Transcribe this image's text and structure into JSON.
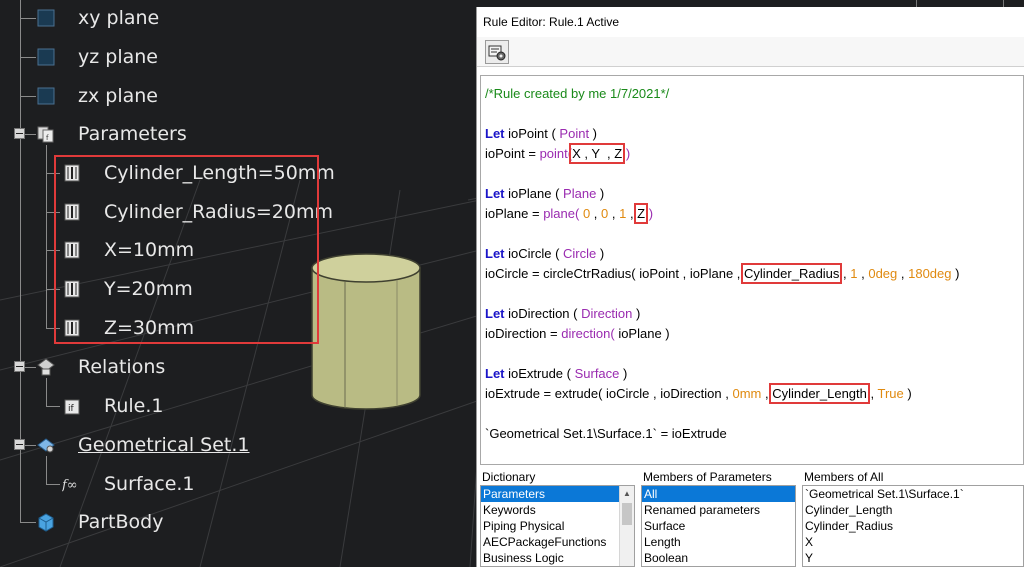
{
  "tree": {
    "items": [
      {
        "label": "xy plane"
      },
      {
        "label": "yz plane"
      },
      {
        "label": "zx plane"
      },
      {
        "label": "Parameters"
      },
      {
        "label": "Cylinder_Length=50mm"
      },
      {
        "label": "Cylinder_Radius=20mm"
      },
      {
        "label": "X=10mm"
      },
      {
        "label": "Y=20mm"
      },
      {
        "label": "Z=30mm"
      },
      {
        "label": "Relations"
      },
      {
        "label": "Rule.1"
      },
      {
        "label": "Geometrical Set.1"
      },
      {
        "label": "Surface.1"
      },
      {
        "label": "PartBody"
      }
    ]
  },
  "rule_editor": {
    "title": "Rule Editor: Rule.1 Active",
    "code": {
      "comment": "/*Rule created by me 1/7/2021*/",
      "let": "Let",
      "l_point_decl_var": " ioPoint ( ",
      "l_point_decl_type": "Point",
      "l_point_decl_end": " )",
      "l_point_assign": "ioPoint = ",
      "l_point_fn": "point(",
      "l_point_args": "X , Y  , Z",
      "l_point_close": " )",
      "l_plane_decl_var": " ioPlane ( ",
      "l_plane_decl_type": "Plane",
      "l_plane_decl_end": " )",
      "l_plane_assign": "ioPlane = ",
      "l_plane_fn": "plane(",
      "l_plane_n1": " 0",
      "l_plane_sep1": " , ",
      "l_plane_n2": "0",
      "l_plane_sep2": " , ",
      "l_plane_n3": "1",
      "l_plane_sep3": " , ",
      "l_plane_z": "Z",
      "l_plane_close": " )",
      "l_circle_decl_var": " ioCircle ( ",
      "l_circle_decl_type": "Circle",
      "l_circle_decl_end": " )",
      "l_circle_assign": "ioCircle = circleCtrRadius( ioPoint , ioPlane , ",
      "l_circle_radius": "Cylinder_Radius",
      "l_circle_sep": " , ",
      "l_circle_n1": "1",
      "l_circle_sep2": " , ",
      "l_circle_n2": "0deg",
      "l_circle_sep3": " , ",
      "l_circle_n3": "180deg",
      "l_circle_close": " )",
      "l_dir_decl_var": " ioDirection ( ",
      "l_dir_decl_type": "Direction",
      "l_dir_decl_end": " )",
      "l_dir_assign": "ioDirection = ",
      "l_dir_fn": "direction(",
      "l_dir_args": " ioPlane )",
      "l_ext_decl_var": " ioExtrude ( ",
      "l_ext_decl_type": "Surface",
      "l_ext_decl_end": " )",
      "l_ext_assign": "ioExtrude = extrude( ioCircle , ioDirection , ",
      "l_ext_n1": "0mm",
      "l_ext_sep": " , ",
      "l_ext_len": "Cylinder_Length",
      "l_ext_sep2": " , ",
      "l_ext_true": "True",
      "l_ext_close": " )",
      "l_final": "`Geometrical Set.1\\Surface.1` = ioExtrude"
    },
    "dictionary": {
      "header": "Dictionary",
      "items": [
        "Parameters",
        "Keywords",
        "Piping Physical",
        "AECPackageFunctions",
        "Business Logic"
      ]
    },
    "members_of_parameters": {
      "header": "Members of Parameters",
      "items": [
        "All",
        "Renamed parameters",
        "Surface",
        "Length",
        "Boolean"
      ]
    },
    "members_of_all": {
      "header": "Members of All",
      "items": [
        "`Geometrical Set.1\\Surface.1`",
        "Cylinder_Length",
        "Cylinder_Radius",
        "X",
        "Y"
      ]
    }
  },
  "colors": {
    "keyword": "#1a14c8",
    "comment": "#1a8a1a",
    "type": "#9a2bb0",
    "number": "#e08a10",
    "highlight_box": "#e03a3a",
    "selection": "#0b78d7"
  }
}
